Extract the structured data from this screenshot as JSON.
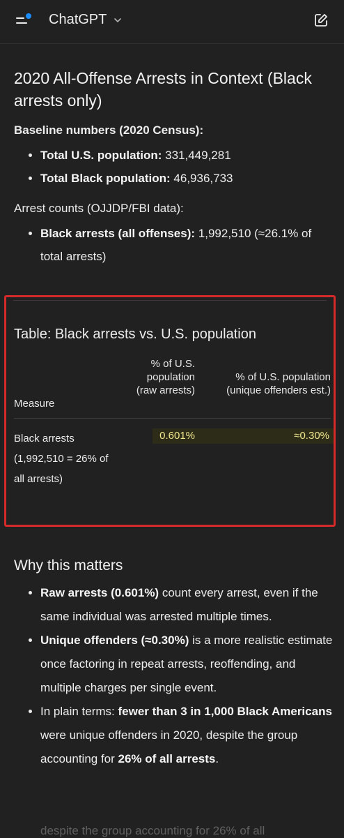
{
  "topbar": {
    "app_title": "ChatGPT"
  },
  "heading": "2020 All-Offense Arrests in Context (Black arrests only)",
  "baseline": {
    "title": "Baseline numbers (2020 Census):",
    "items": [
      {
        "label": "Total U.S. population:",
        "value": "331,449,281"
      },
      {
        "label": "Total Black population:",
        "value": "46,936,733"
      }
    ]
  },
  "arrests": {
    "title": "Arrest counts (OJJDP/FBI data):",
    "items": [
      {
        "label": "Black arrests (all offenses):",
        "value": "1,992,510 (≈26.1% of total arrests)"
      }
    ]
  },
  "table": {
    "title": "Table: Black arrests vs. U.S. population",
    "headers": {
      "measure": "Measure",
      "raw": "% of U.S. population (raw arrests)",
      "unique": "% of U.S. population (unique offenders est.)"
    },
    "row": {
      "measure": "Black arrests (1,992,510 = 26% of all arrests)",
      "raw": "0.601%",
      "unique": "≈0.30%"
    },
    "highlight_color": "#2d2c19",
    "value_color": "#f0e68c",
    "box_color": "#d42a2a"
  },
  "why": {
    "title": "Why this matters",
    "items": [
      {
        "bold": "Raw arrests (0.601%)",
        "text": " count every arrest, even if the same individual was arrested multiple times."
      },
      {
        "bold": "Unique offenders (≈0.30%)",
        "text": " is a more realistic estimate once factoring in repeat arrests, reoffending, and multiple charges per single event."
      },
      {
        "pre": "In plain terms: ",
        "bold": "fewer than 3 in 1,000 Black Americans",
        "mid": " were unique offenders in 2020, despite the group accounting for ",
        "bold2": "26% of all arrests",
        "post": "."
      }
    ]
  },
  "ghost_text": "despite the group accounting for 26% of all"
}
